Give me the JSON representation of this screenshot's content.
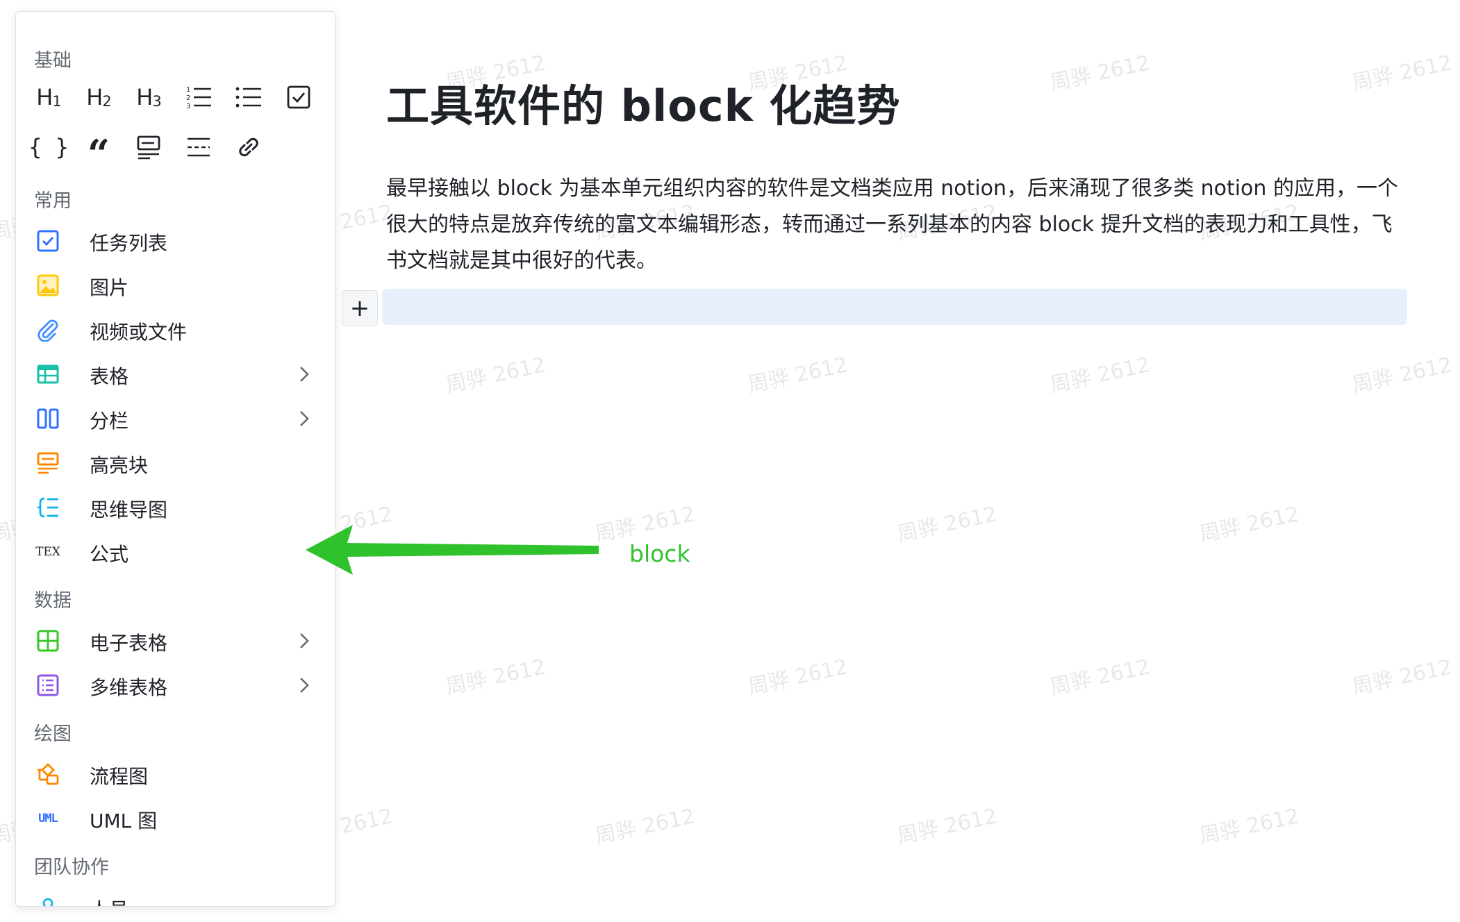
{
  "watermark": "周骅 2612",
  "menu": {
    "sections": {
      "basic": "基础",
      "common": "常用",
      "data": "数据",
      "drawing": "绘图",
      "team": "团队协作"
    },
    "basic_tools": {
      "h1": {
        "letter": "H",
        "num": "1"
      },
      "h2": {
        "letter": "H",
        "num": "2"
      },
      "h3": {
        "letter": "H",
        "num": "3"
      }
    },
    "common_items": [
      {
        "label": "任务列表",
        "icon": "task-list-icon"
      },
      {
        "label": "图片",
        "icon": "image-icon"
      },
      {
        "label": "视频或文件",
        "icon": "attachment-icon"
      },
      {
        "label": "表格",
        "icon": "table-icon"
      },
      {
        "label": "分栏",
        "icon": "columns-icon"
      },
      {
        "label": "高亮块",
        "icon": "callout-icon"
      },
      {
        "label": "思维导图",
        "icon": "mindmap-icon"
      },
      {
        "label": "公式",
        "icon": "tex-icon",
        "icon_text": "TEX"
      }
    ],
    "data_items": [
      {
        "label": "电子表格",
        "icon": "sheet-icon"
      },
      {
        "label": "多维表格",
        "icon": "bitable-icon"
      }
    ],
    "drawing_items": [
      {
        "label": "流程图",
        "icon": "flowchart-icon"
      },
      {
        "label": "UML 图",
        "icon": "uml-icon",
        "icon_text": "UML"
      }
    ],
    "team_items": [
      {
        "label": "人员",
        "icon": "person-icon"
      }
    ]
  },
  "document": {
    "title": "工具软件的 block 化趋势",
    "paragraph": "最早接触以 block 为基本单元组织内容的软件是文档类应用 notion，后来涌现了很多类 notion 的应用，一个很大的特点是放弃传统的富文本编辑形态，转而通过一系列基本的内容 block 提升文档的表现力和工具性，飞书文档就是其中很好的代表。",
    "add_button": "+"
  },
  "annotation": {
    "label": "block",
    "color": "#30c22d"
  },
  "colors": {
    "accent_blue": "#3370ff",
    "yellow": "#ffc60a",
    "teal": "#14c0a6",
    "orange": "#ff8800",
    "cyan": "#0fb5e6",
    "green": "#34c724",
    "purple": "#8d55ed",
    "new_block_bg": "#e9f0fd"
  }
}
